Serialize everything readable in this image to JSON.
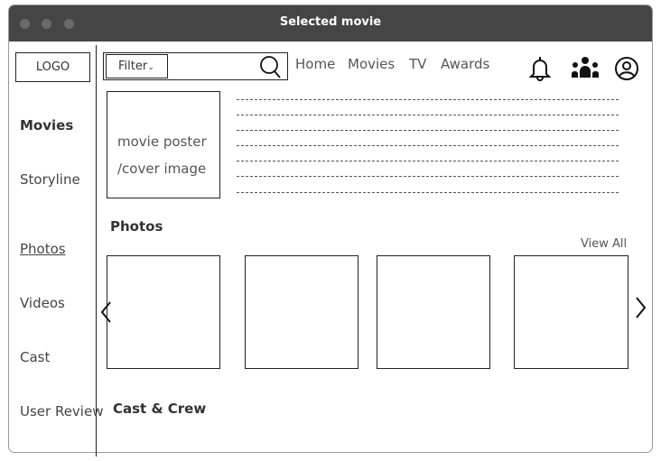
{
  "window": {
    "title": "Selected movie"
  },
  "header": {
    "logo": "LOGO",
    "filter_label": "Filter",
    "nav": [
      "Home",
      "Movies",
      "TV",
      "Awards"
    ]
  },
  "sidebar": {
    "items": [
      "Movies",
      "Storyline",
      "Photos",
      "Videos",
      "Cast",
      "User Review"
    ]
  },
  "poster": {
    "line1": "movie poster",
    "line2": "/cover image"
  },
  "photos": {
    "heading": "Photos",
    "view_all": "View All"
  },
  "cast": {
    "heading": "Cast & Crew"
  }
}
